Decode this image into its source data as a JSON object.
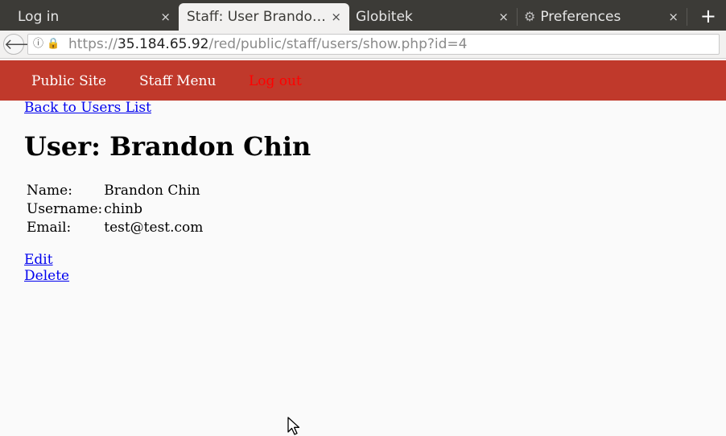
{
  "browser": {
    "tabs": [
      {
        "title": "Log in",
        "close": "×"
      },
      {
        "title": "Staff: User Brando…",
        "close": "×"
      },
      {
        "title": "Globitek",
        "close": "×"
      },
      {
        "title": "Preferences",
        "close": "×"
      }
    ],
    "new_tab": "+",
    "back_glyph": "🡐",
    "url_host": "35.184.65.92",
    "url_scheme": "https://",
    "url_path": "/red/public/staff/users/show.php?id=4"
  },
  "nav": {
    "public_site": "Public Site",
    "staff_menu": "Staff Menu",
    "log_out": "Log out"
  },
  "page": {
    "back_link": "Back to Users List",
    "title": "User: Brandon Chin",
    "fields": [
      {
        "label": "Name:",
        "value": "Brandon Chin"
      },
      {
        "label": "Username:",
        "value": "chinb"
      },
      {
        "label": "Email:",
        "value": "test@test.com"
      }
    ],
    "actions": {
      "edit": "Edit",
      "delete": "Delete"
    }
  },
  "icons": {
    "info": "info-icon",
    "lock": "lock-warning-icon",
    "gear": "gear-icon",
    "cursor": "mouse-cursor-icon"
  }
}
